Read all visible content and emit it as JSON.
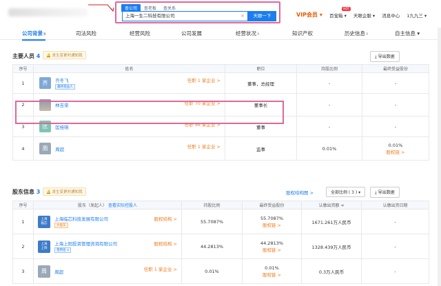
{
  "header": {
    "search_tabs": [
      "查公司",
      "查老板",
      "查关系"
    ],
    "search_value": "上海一生二科技有限公司",
    "search_button": "天眼一下",
    "vip": "VIP会员",
    "nav": [
      {
        "label": "百宝箱",
        "hot": "HOT"
      },
      {
        "label": "天眼企服",
        "hot": ""
      },
      {
        "label": "消息中心",
        "hot": ""
      },
      {
        "label": "1九九三",
        "hot": ""
      }
    ]
  },
  "tabs": [
    {
      "label": "公司背景",
      "count": "8"
    },
    {
      "label": "司法风险",
      "count": ""
    },
    {
      "label": "经营风险",
      "count": ""
    },
    {
      "label": "公司发展",
      "count": ""
    },
    {
      "label": "经营状况",
      "count": "9"
    },
    {
      "label": "知识产权",
      "count": ""
    },
    {
      "label": "历史信息",
      "count": "4"
    },
    {
      "label": "自主信息",
      "count": ""
    }
  ],
  "personnel": {
    "title": "主要人员",
    "count": "4",
    "notice": "发生变更时通知我",
    "export": "导出数据",
    "columns": [
      "序号",
      "姓名",
      "职位",
      "持股比例",
      "最终受益股份"
    ],
    "rows": [
      {
        "no": "1",
        "avatar": "齐",
        "avatar_color": "#7fa8d6",
        "name": "齐冬飞",
        "badge": "最终受益人",
        "related": "任职 1 家企业 >",
        "position": "董事，总经理",
        "share": "-",
        "benefit": "-",
        "benefit_link": ""
      },
      {
        "no": "2",
        "avatar": "",
        "avatar_color": "",
        "name": "林吉荣",
        "badge": "",
        "related": "任职 70 家企业 >",
        "position": "董事长",
        "share": "-",
        "benefit": "-",
        "benefit_link": ""
      },
      {
        "no": "3",
        "avatar": "匡",
        "avatar_color": "#80c4b5",
        "name": "匡桂晓",
        "badge": "",
        "related": "任职 46 家企业 >",
        "position": "董事",
        "share": "-",
        "benefit": "-",
        "benefit_link": ""
      },
      {
        "no": "4",
        "avatar": "周",
        "avatar_color": "#9aa9b7",
        "name": "周超",
        "badge": "",
        "related": "任职 1 家企业 >",
        "position": "监事",
        "share": "0.01%",
        "benefit": "0.01%",
        "benefit_link": "股权链 >"
      }
    ]
  },
  "shareholders": {
    "title": "股东信息",
    "count": "3",
    "notice": "发生变更时通知我",
    "structure_link": "股权结构图 >",
    "filter": "全部比例 ( 3 )",
    "export": "导出数据",
    "columns": [
      "序号",
      "股东（发起人）",
      "查看实际控股人",
      "持股比例",
      "最终受益股份",
      "认缴出资额 ≑",
      "认缴出资日期"
    ],
    "rows": [
      {
        "no": "1",
        "logo": "上海\n临芯",
        "logo_color": "#3d7bc8",
        "name": "上海临芯科技发展有限公司",
        "badge": "大股东",
        "link": "股权结构 >",
        "share": "55.7087%",
        "benefit": "55.7087%",
        "benefit_link": "股权链 >",
        "capital": "1671.261万人民币",
        "date": "-"
      },
      {
        "no": "2",
        "logo": "上海\n上阳",
        "logo_color": "#3d7bc8",
        "name": "上海上阳投资管理咨询有限公司",
        "badge": "曾用名 ∨",
        "link": "股权结构 >",
        "share": "44.2813%",
        "benefit": "44.2813%",
        "benefit_link": "股权链 >",
        "capital": "1328.439万人民币",
        "date": "-"
      },
      {
        "no": "3",
        "logo": "周",
        "logo_color": "#9aa9b7",
        "name": "周超",
        "badge": "",
        "link": "任职 1 家企业 >",
        "share": "0.01%",
        "benefit": "0.01%",
        "benefit_link": "股权链 >",
        "capital": "0.3万人民币",
        "date": "-"
      }
    ]
  }
}
